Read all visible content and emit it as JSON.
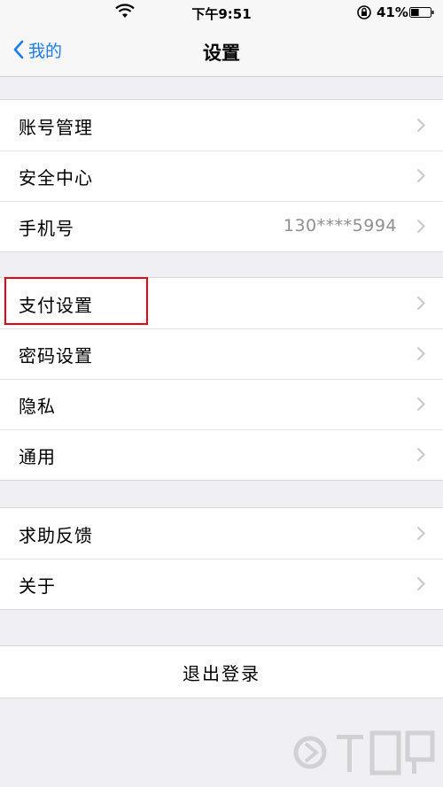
{
  "status_bar": {
    "time": "下午9:51",
    "battery_percent": "41%",
    "battery_level": 0.41,
    "icons": [
      "wifi-icon",
      "rotation-lock-icon",
      "battery-icon"
    ]
  },
  "nav": {
    "back_label": "我的",
    "title": "设置"
  },
  "groups": [
    {
      "items": [
        {
          "label": "账号管理",
          "value": ""
        },
        {
          "label": "安全中心",
          "value": ""
        },
        {
          "label": "手机号",
          "value": "130****5994"
        }
      ]
    },
    {
      "items": [
        {
          "label": "支付设置",
          "value": "",
          "highlighted": true
        },
        {
          "label": "密码设置",
          "value": ""
        },
        {
          "label": "隐私",
          "value": ""
        },
        {
          "label": "通用",
          "value": ""
        }
      ]
    },
    {
      "items": [
        {
          "label": "求助反馈",
          "value": ""
        },
        {
          "label": "关于",
          "value": ""
        }
      ]
    }
  ],
  "logout_label": "退出登录",
  "colors": {
    "accent": "#1a7cf5",
    "highlight": "#e60012",
    "background": "#efeff4",
    "secondary_text": "#8e8e93"
  }
}
